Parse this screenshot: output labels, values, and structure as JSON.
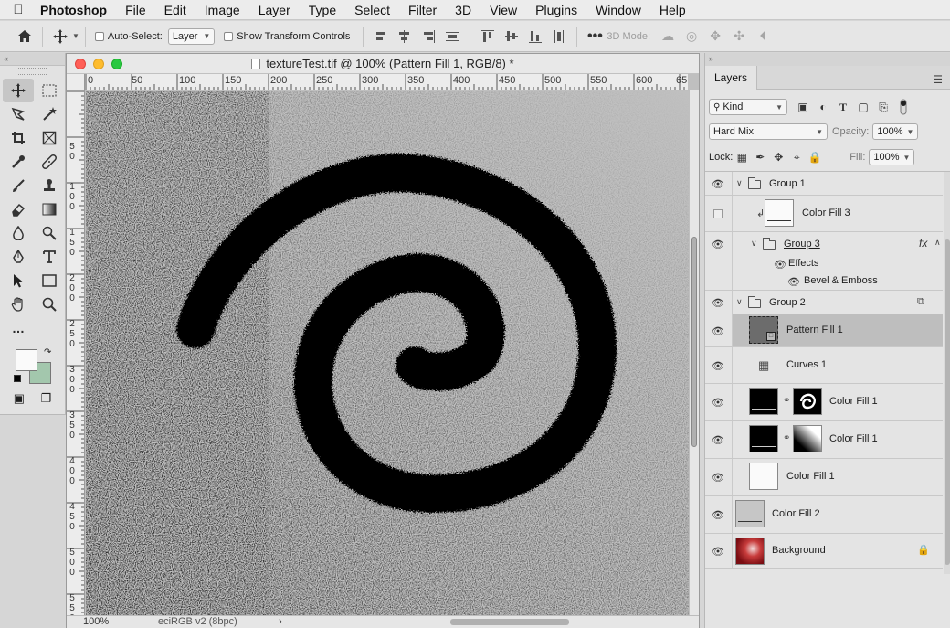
{
  "menubar": {
    "app_name": "Photoshop",
    "items": [
      "File",
      "Edit",
      "Image",
      "Layer",
      "Type",
      "Select",
      "Filter",
      "3D",
      "View",
      "Plugins",
      "Window",
      "Help"
    ]
  },
  "options": {
    "auto_select_label": "Auto-Select:",
    "auto_select_target": "Layer",
    "show_transform_label": "Show Transform Controls",
    "three_d_mode_label": "3D Mode:"
  },
  "colors": {
    "foreground": "#fafafa",
    "background": "#a3c7ad",
    "canvas_gray": "#c0c0c0"
  },
  "document": {
    "title": "textureTest.tif @ 100% (Pattern Fill 1, RGB/8) *",
    "zoom": "100%",
    "color_profile": "eciRGB v2 (8bpc)",
    "status_chevron": "›",
    "ruler_top": [
      "0",
      "50",
      "100",
      "150",
      "200",
      "250",
      "300",
      "350",
      "400",
      "450",
      "500",
      "550",
      "600",
      "65"
    ],
    "ruler_left": [
      [
        "5",
        "0"
      ],
      [
        "1",
        "0",
        "0"
      ],
      [
        "1",
        "5",
        "0"
      ],
      [
        "2",
        "0",
        "0"
      ],
      [
        "2",
        "5",
        "0"
      ],
      [
        "3",
        "0",
        "0"
      ],
      [
        "3",
        "5",
        "0"
      ],
      [
        "4",
        "0",
        "0"
      ],
      [
        "4",
        "5",
        "0"
      ],
      [
        "5",
        "0",
        "0"
      ],
      [
        "5",
        "5",
        "0"
      ]
    ]
  },
  "layers_panel": {
    "tab_label": "Layers",
    "filter_kind": "Kind",
    "blend_mode": "Hard Mix",
    "opacity_label": "Opacity:",
    "opacity_value": "100%",
    "lock_label": "Lock:",
    "fill_label": "Fill:",
    "fill_value": "100%",
    "layers": [
      {
        "name": "Group 1",
        "kind": "group"
      },
      {
        "name": "Color Fill 3",
        "kind": "fill"
      },
      {
        "name": "Group 3",
        "kind": "group"
      },
      {
        "name": "Effects",
        "kind": "effects"
      },
      {
        "name": "Bevel & Emboss",
        "kind": "effect"
      },
      {
        "name": "Group 2",
        "kind": "group"
      },
      {
        "name": "Pattern Fill 1",
        "kind": "pattern"
      },
      {
        "name": "Curves 1",
        "kind": "adjustment"
      },
      {
        "name": "Color Fill 1",
        "kind": "fill-masked"
      },
      {
        "name": "Color Fill 1",
        "kind": "fill-masked"
      },
      {
        "name": "Color Fill 1",
        "kind": "fill"
      },
      {
        "name": "Color Fill 2",
        "kind": "fill"
      },
      {
        "name": "Background",
        "kind": "image"
      }
    ],
    "fx_label": "fx"
  }
}
